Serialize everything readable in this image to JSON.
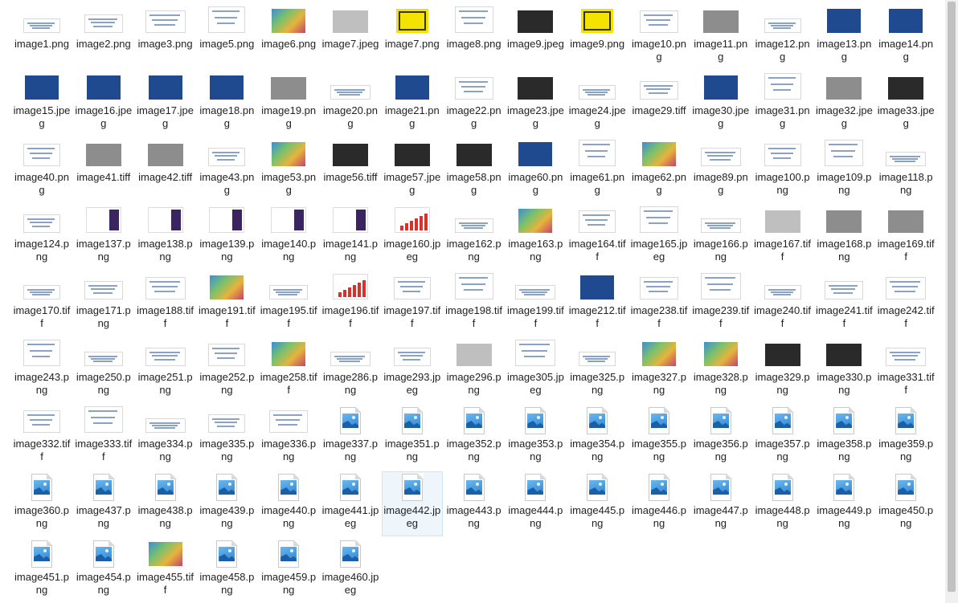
{
  "window": {
    "view": "Large icons"
  },
  "colors": {
    "selection_bg": "#eef6fc",
    "selection_border": "#cde6f7",
    "icon_blue": "#2f86d6"
  },
  "files": [
    {
      "name": "image1.png",
      "thumb": "light"
    },
    {
      "name": "image2.png",
      "thumb": "light"
    },
    {
      "name": "image3.png",
      "thumb": "light"
    },
    {
      "name": "image5.png",
      "thumb": "light"
    },
    {
      "name": "image6.png",
      "thumb": "colorful"
    },
    {
      "name": "image7.jpeg",
      "thumb": "mesh"
    },
    {
      "name": "image7.png",
      "thumb": "yellow"
    },
    {
      "name": "image8.png",
      "thumb": "light"
    },
    {
      "name": "image9.jpeg",
      "thumb": "dark"
    },
    {
      "name": "image9.png",
      "thumb": "yellow"
    },
    {
      "name": "image10.png",
      "thumb": "light"
    },
    {
      "name": "image11.png",
      "thumb": "gray"
    },
    {
      "name": "image12.png",
      "thumb": "light"
    },
    {
      "name": "image13.png",
      "thumb": "blue"
    },
    {
      "name": "image14.png",
      "thumb": "blue"
    },
    {
      "name": "image15.jpeg",
      "thumb": "blue"
    },
    {
      "name": "image16.jpeg",
      "thumb": "blue"
    },
    {
      "name": "image17.jpeg",
      "thumb": "blue"
    },
    {
      "name": "image18.png",
      "thumb": "blue"
    },
    {
      "name": "image19.png",
      "thumb": "gray"
    },
    {
      "name": "image20.png",
      "thumb": "light"
    },
    {
      "name": "image21.png",
      "thumb": "blue"
    },
    {
      "name": "image22.png",
      "thumb": "light"
    },
    {
      "name": "image23.jpeg",
      "thumb": "dark"
    },
    {
      "name": "image24.jpeg",
      "thumb": "light"
    },
    {
      "name": "image29.tiff",
      "thumb": "light"
    },
    {
      "name": "image30.jpeg",
      "thumb": "blue"
    },
    {
      "name": "image31.png",
      "thumb": "light"
    },
    {
      "name": "image32.jpeg",
      "thumb": "gray"
    },
    {
      "name": "image33.jpeg",
      "thumb": "dark"
    },
    {
      "name": "image40.png",
      "thumb": "light"
    },
    {
      "name": "image41.tiff",
      "thumb": "gray"
    },
    {
      "name": "image42.tiff",
      "thumb": "gray"
    },
    {
      "name": "image43.png",
      "thumb": "light"
    },
    {
      "name": "image53.png",
      "thumb": "colorful"
    },
    {
      "name": "image56.tiff",
      "thumb": "dark"
    },
    {
      "name": "image57.jpeg",
      "thumb": "dark"
    },
    {
      "name": "image58.png",
      "thumb": "dark"
    },
    {
      "name": "image60.png",
      "thumb": "blue"
    },
    {
      "name": "image61.png",
      "thumb": "light"
    },
    {
      "name": "image62.png",
      "thumb": "colorful"
    },
    {
      "name": "image89.png",
      "thumb": "light"
    },
    {
      "name": "image100.png",
      "thumb": "light"
    },
    {
      "name": "image109.png",
      "thumb": "light"
    },
    {
      "name": "image118.png",
      "thumb": "light"
    },
    {
      "name": "image124.png",
      "thumb": "light"
    },
    {
      "name": "image137.png",
      "thumb": "purple"
    },
    {
      "name": "image138.png",
      "thumb": "purple"
    },
    {
      "name": "image139.png",
      "thumb": "purple"
    },
    {
      "name": "image140.png",
      "thumb": "purple"
    },
    {
      "name": "image141.png",
      "thumb": "purple"
    },
    {
      "name": "image160.jpeg",
      "thumb": "red"
    },
    {
      "name": "image162.png",
      "thumb": "light"
    },
    {
      "name": "image163.png",
      "thumb": "colorful"
    },
    {
      "name": "image164.tiff",
      "thumb": "light"
    },
    {
      "name": "image165.jpeg",
      "thumb": "light"
    },
    {
      "name": "image166.png",
      "thumb": "light"
    },
    {
      "name": "image167.tiff",
      "thumb": "mesh"
    },
    {
      "name": "image168.png",
      "thumb": "gray"
    },
    {
      "name": "image169.tiff",
      "thumb": "gray"
    },
    {
      "name": "image170.tiff",
      "thumb": "light"
    },
    {
      "name": "image171.png",
      "thumb": "light"
    },
    {
      "name": "image188.tiff",
      "thumb": "light"
    },
    {
      "name": "image191.tiff",
      "thumb": "colorful"
    },
    {
      "name": "image195.tiff",
      "thumb": "light"
    },
    {
      "name": "image196.tiff",
      "thumb": "red"
    },
    {
      "name": "image197.tiff",
      "thumb": "light"
    },
    {
      "name": "image198.tiff",
      "thumb": "light"
    },
    {
      "name": "image199.tiff",
      "thumb": "light"
    },
    {
      "name": "image212.tiff",
      "thumb": "blue"
    },
    {
      "name": "image238.tiff",
      "thumb": "light"
    },
    {
      "name": "image239.tiff",
      "thumb": "light"
    },
    {
      "name": "image240.tiff",
      "thumb": "light"
    },
    {
      "name": "image241.tiff",
      "thumb": "light"
    },
    {
      "name": "image242.tiff",
      "thumb": "light"
    },
    {
      "name": "image243.png",
      "thumb": "light"
    },
    {
      "name": "image250.png",
      "thumb": "light"
    },
    {
      "name": "image251.png",
      "thumb": "light"
    },
    {
      "name": "image252.png",
      "thumb": "light"
    },
    {
      "name": "image258.tiff",
      "thumb": "colorful"
    },
    {
      "name": "image286.png",
      "thumb": "light"
    },
    {
      "name": "image293.jpeg",
      "thumb": "light"
    },
    {
      "name": "image296.png",
      "thumb": "mesh"
    },
    {
      "name": "image305.jpeg",
      "thumb": "light"
    },
    {
      "name": "image325.png",
      "thumb": "light"
    },
    {
      "name": "image327.png",
      "thumb": "colorful"
    },
    {
      "name": "image328.png",
      "thumb": "colorful"
    },
    {
      "name": "image329.png",
      "thumb": "dark"
    },
    {
      "name": "image330.png",
      "thumb": "dark"
    },
    {
      "name": "image331.tiff",
      "thumb": "light"
    },
    {
      "name": "image332.tiff",
      "thumb": "light"
    },
    {
      "name": "image333.tiff",
      "thumb": "light"
    },
    {
      "name": "image334.png",
      "thumb": "light"
    },
    {
      "name": "image335.png",
      "thumb": "light"
    },
    {
      "name": "image336.png",
      "thumb": "light"
    },
    {
      "name": "image337.png",
      "thumb": "icon"
    },
    {
      "name": "image351.png",
      "thumb": "icon"
    },
    {
      "name": "image352.png",
      "thumb": "icon"
    },
    {
      "name": "image353.png",
      "thumb": "icon"
    },
    {
      "name": "image354.png",
      "thumb": "icon"
    },
    {
      "name": "image355.png",
      "thumb": "icon"
    },
    {
      "name": "image356.png",
      "thumb": "icon"
    },
    {
      "name": "image357.png",
      "thumb": "icon"
    },
    {
      "name": "image358.png",
      "thumb": "icon"
    },
    {
      "name": "image359.png",
      "thumb": "icon"
    },
    {
      "name": "image360.png",
      "thumb": "icon"
    },
    {
      "name": "image437.png",
      "thumb": "icon"
    },
    {
      "name": "image438.png",
      "thumb": "icon"
    },
    {
      "name": "image439.png",
      "thumb": "icon"
    },
    {
      "name": "image440.png",
      "thumb": "icon"
    },
    {
      "name": "image441.jpeg",
      "thumb": "icon"
    },
    {
      "name": "image442.jpeg",
      "thumb": "icon",
      "selected": true
    },
    {
      "name": "image443.png",
      "thumb": "icon"
    },
    {
      "name": "image444.png",
      "thumb": "icon"
    },
    {
      "name": "image445.png",
      "thumb": "icon"
    },
    {
      "name": "image446.png",
      "thumb": "icon"
    },
    {
      "name": "image447.png",
      "thumb": "icon"
    },
    {
      "name": "image448.png",
      "thumb": "icon"
    },
    {
      "name": "image449.png",
      "thumb": "icon"
    },
    {
      "name": "image450.png",
      "thumb": "icon"
    },
    {
      "name": "image451.png",
      "thumb": "icon"
    },
    {
      "name": "image454.png",
      "thumb": "icon"
    },
    {
      "name": "image455.tiff",
      "thumb": "colorful"
    },
    {
      "name": "image458.png",
      "thumb": "icon"
    },
    {
      "name": "image459.png",
      "thumb": "icon"
    },
    {
      "name": "image460.jpeg",
      "thumb": "icon"
    }
  ]
}
